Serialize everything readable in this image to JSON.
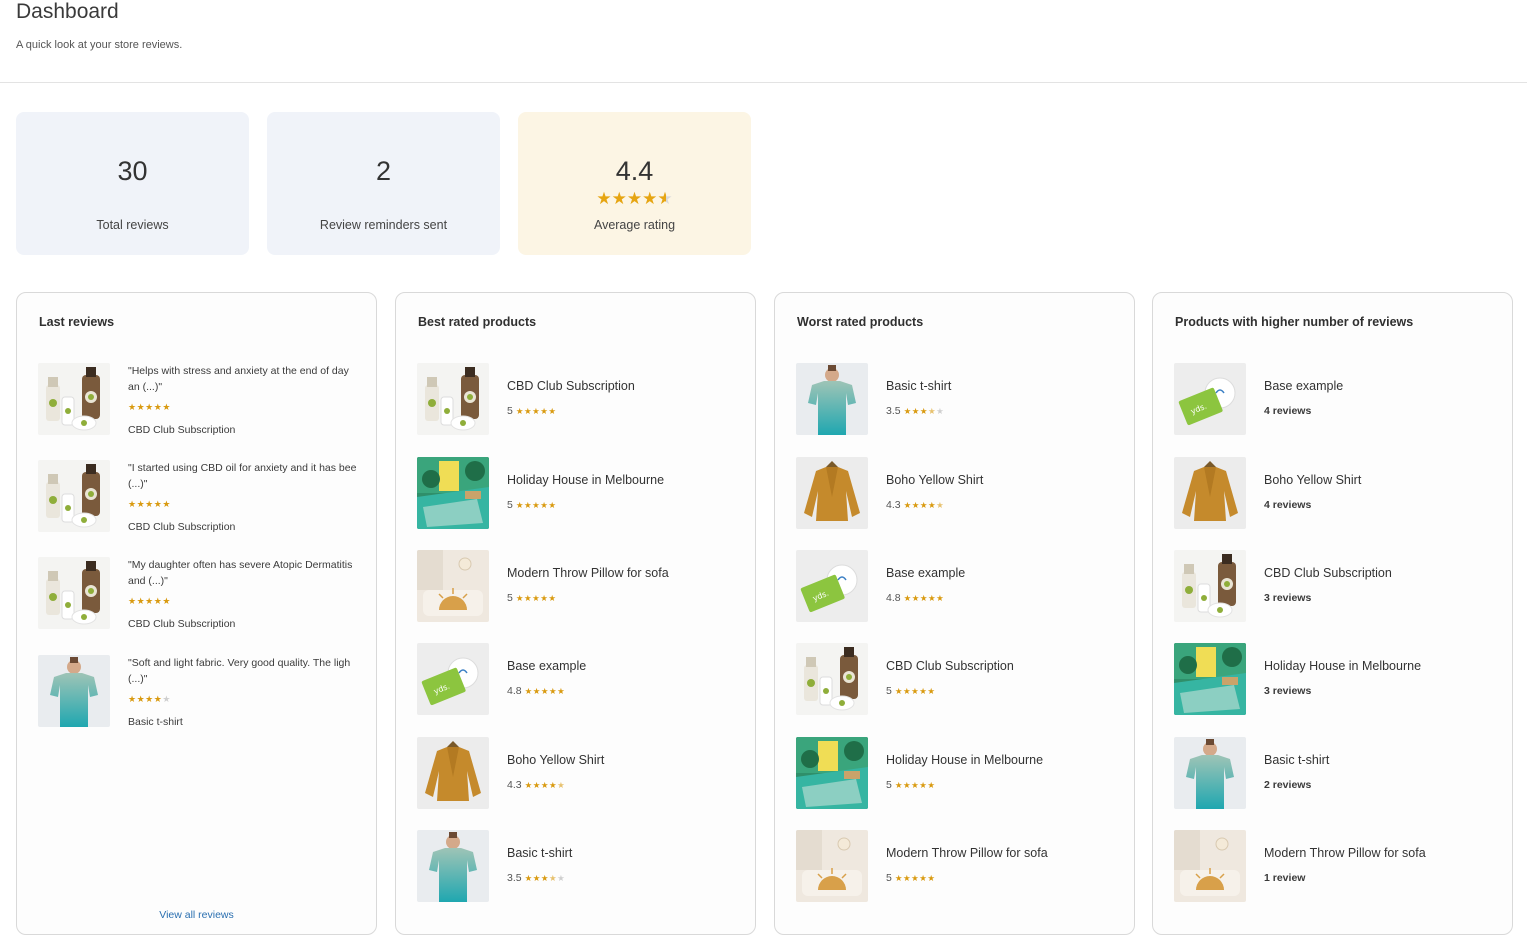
{
  "header": {
    "title": "Dashboard",
    "subtitle": "A quick look at your store reviews."
  },
  "stats": {
    "total_reviews": {
      "value": "30",
      "label": "Total reviews"
    },
    "reminders_sent": {
      "value": "2",
      "label": "Review reminders sent"
    },
    "average_rating": {
      "value": "4.4",
      "label": "Average rating",
      "rating": 4.4
    }
  },
  "colors": {
    "star": "#e6a512",
    "link": "#2a6fb0",
    "stat_blue_bg": "#f0f3f9",
    "stat_amber_bg": "#fcf5e4"
  },
  "last_reviews": {
    "title": "Last reviews",
    "view_all": "View all reviews",
    "items": [
      {
        "quote": "\"Helps with stress and anxiety at the end of day an (...)\"",
        "stars": 5,
        "product": "CBD Club Subscription",
        "thumb": "cbd"
      },
      {
        "quote": "\"I started using CBD oil for anxiety and it has bee (...)\"",
        "stars": 5,
        "product": "CBD Club Subscription",
        "thumb": "cbd"
      },
      {
        "quote": "\"My daughter often has severe Atopic Dermatitis and (...)\"",
        "stars": 5,
        "product": "CBD Club Subscription",
        "thumb": "cbd"
      },
      {
        "quote": "\"Soft and light fabric. Very good quality. The ligh (...)\"",
        "stars": 4,
        "product": "Basic t-shirt",
        "thumb": "tshirt"
      }
    ]
  },
  "best_rated": {
    "title": "Best rated products",
    "items": [
      {
        "name": "CBD Club Subscription",
        "rating": "5",
        "stars": 5,
        "thumb": "cbd"
      },
      {
        "name": "Holiday House in Melbourne",
        "rating": "5",
        "stars": 5,
        "thumb": "house"
      },
      {
        "name": "Modern Throw Pillow for sofa",
        "rating": "5",
        "stars": 5,
        "thumb": "pillow"
      },
      {
        "name": "Base example",
        "rating": "4.8",
        "stars": 5,
        "thumb": "card"
      },
      {
        "name": "Boho Yellow Shirt",
        "rating": "4.3",
        "stars": 4.5,
        "thumb": "shirt"
      },
      {
        "name": "Basic t-shirt",
        "rating": "3.5",
        "stars": 3.5,
        "thumb": "tshirt"
      }
    ]
  },
  "worst_rated": {
    "title": "Worst rated products",
    "items": [
      {
        "name": "Basic t-shirt",
        "rating": "3.5",
        "stars": 3.5,
        "thumb": "tshirt"
      },
      {
        "name": "Boho Yellow Shirt",
        "rating": "4.3",
        "stars": 4.5,
        "thumb": "shirt"
      },
      {
        "name": "Base example",
        "rating": "4.8",
        "stars": 5,
        "thumb": "card"
      },
      {
        "name": "CBD Club Subscription",
        "rating": "5",
        "stars": 5,
        "thumb": "cbd"
      },
      {
        "name": "Holiday House in Melbourne",
        "rating": "5",
        "stars": 5,
        "thumb": "house"
      },
      {
        "name": "Modern Throw Pillow for sofa",
        "rating": "5",
        "stars": 5,
        "thumb": "pillow"
      }
    ]
  },
  "most_reviewed": {
    "title": "Products with higher number of reviews",
    "items": [
      {
        "name": "Base example",
        "count": "4 reviews",
        "thumb": "card"
      },
      {
        "name": "Boho Yellow Shirt",
        "count": "4 reviews",
        "thumb": "shirt"
      },
      {
        "name": "CBD Club Subscription",
        "count": "3 reviews",
        "thumb": "cbd"
      },
      {
        "name": "Holiday House in Melbourne",
        "count": "3 reviews",
        "thumb": "house"
      },
      {
        "name": "Basic t-shirt",
        "count": "2 reviews",
        "thumb": "tshirt"
      },
      {
        "name": "Modern Throw Pillow for sofa",
        "count": "1 review",
        "thumb": "pillow"
      }
    ]
  }
}
